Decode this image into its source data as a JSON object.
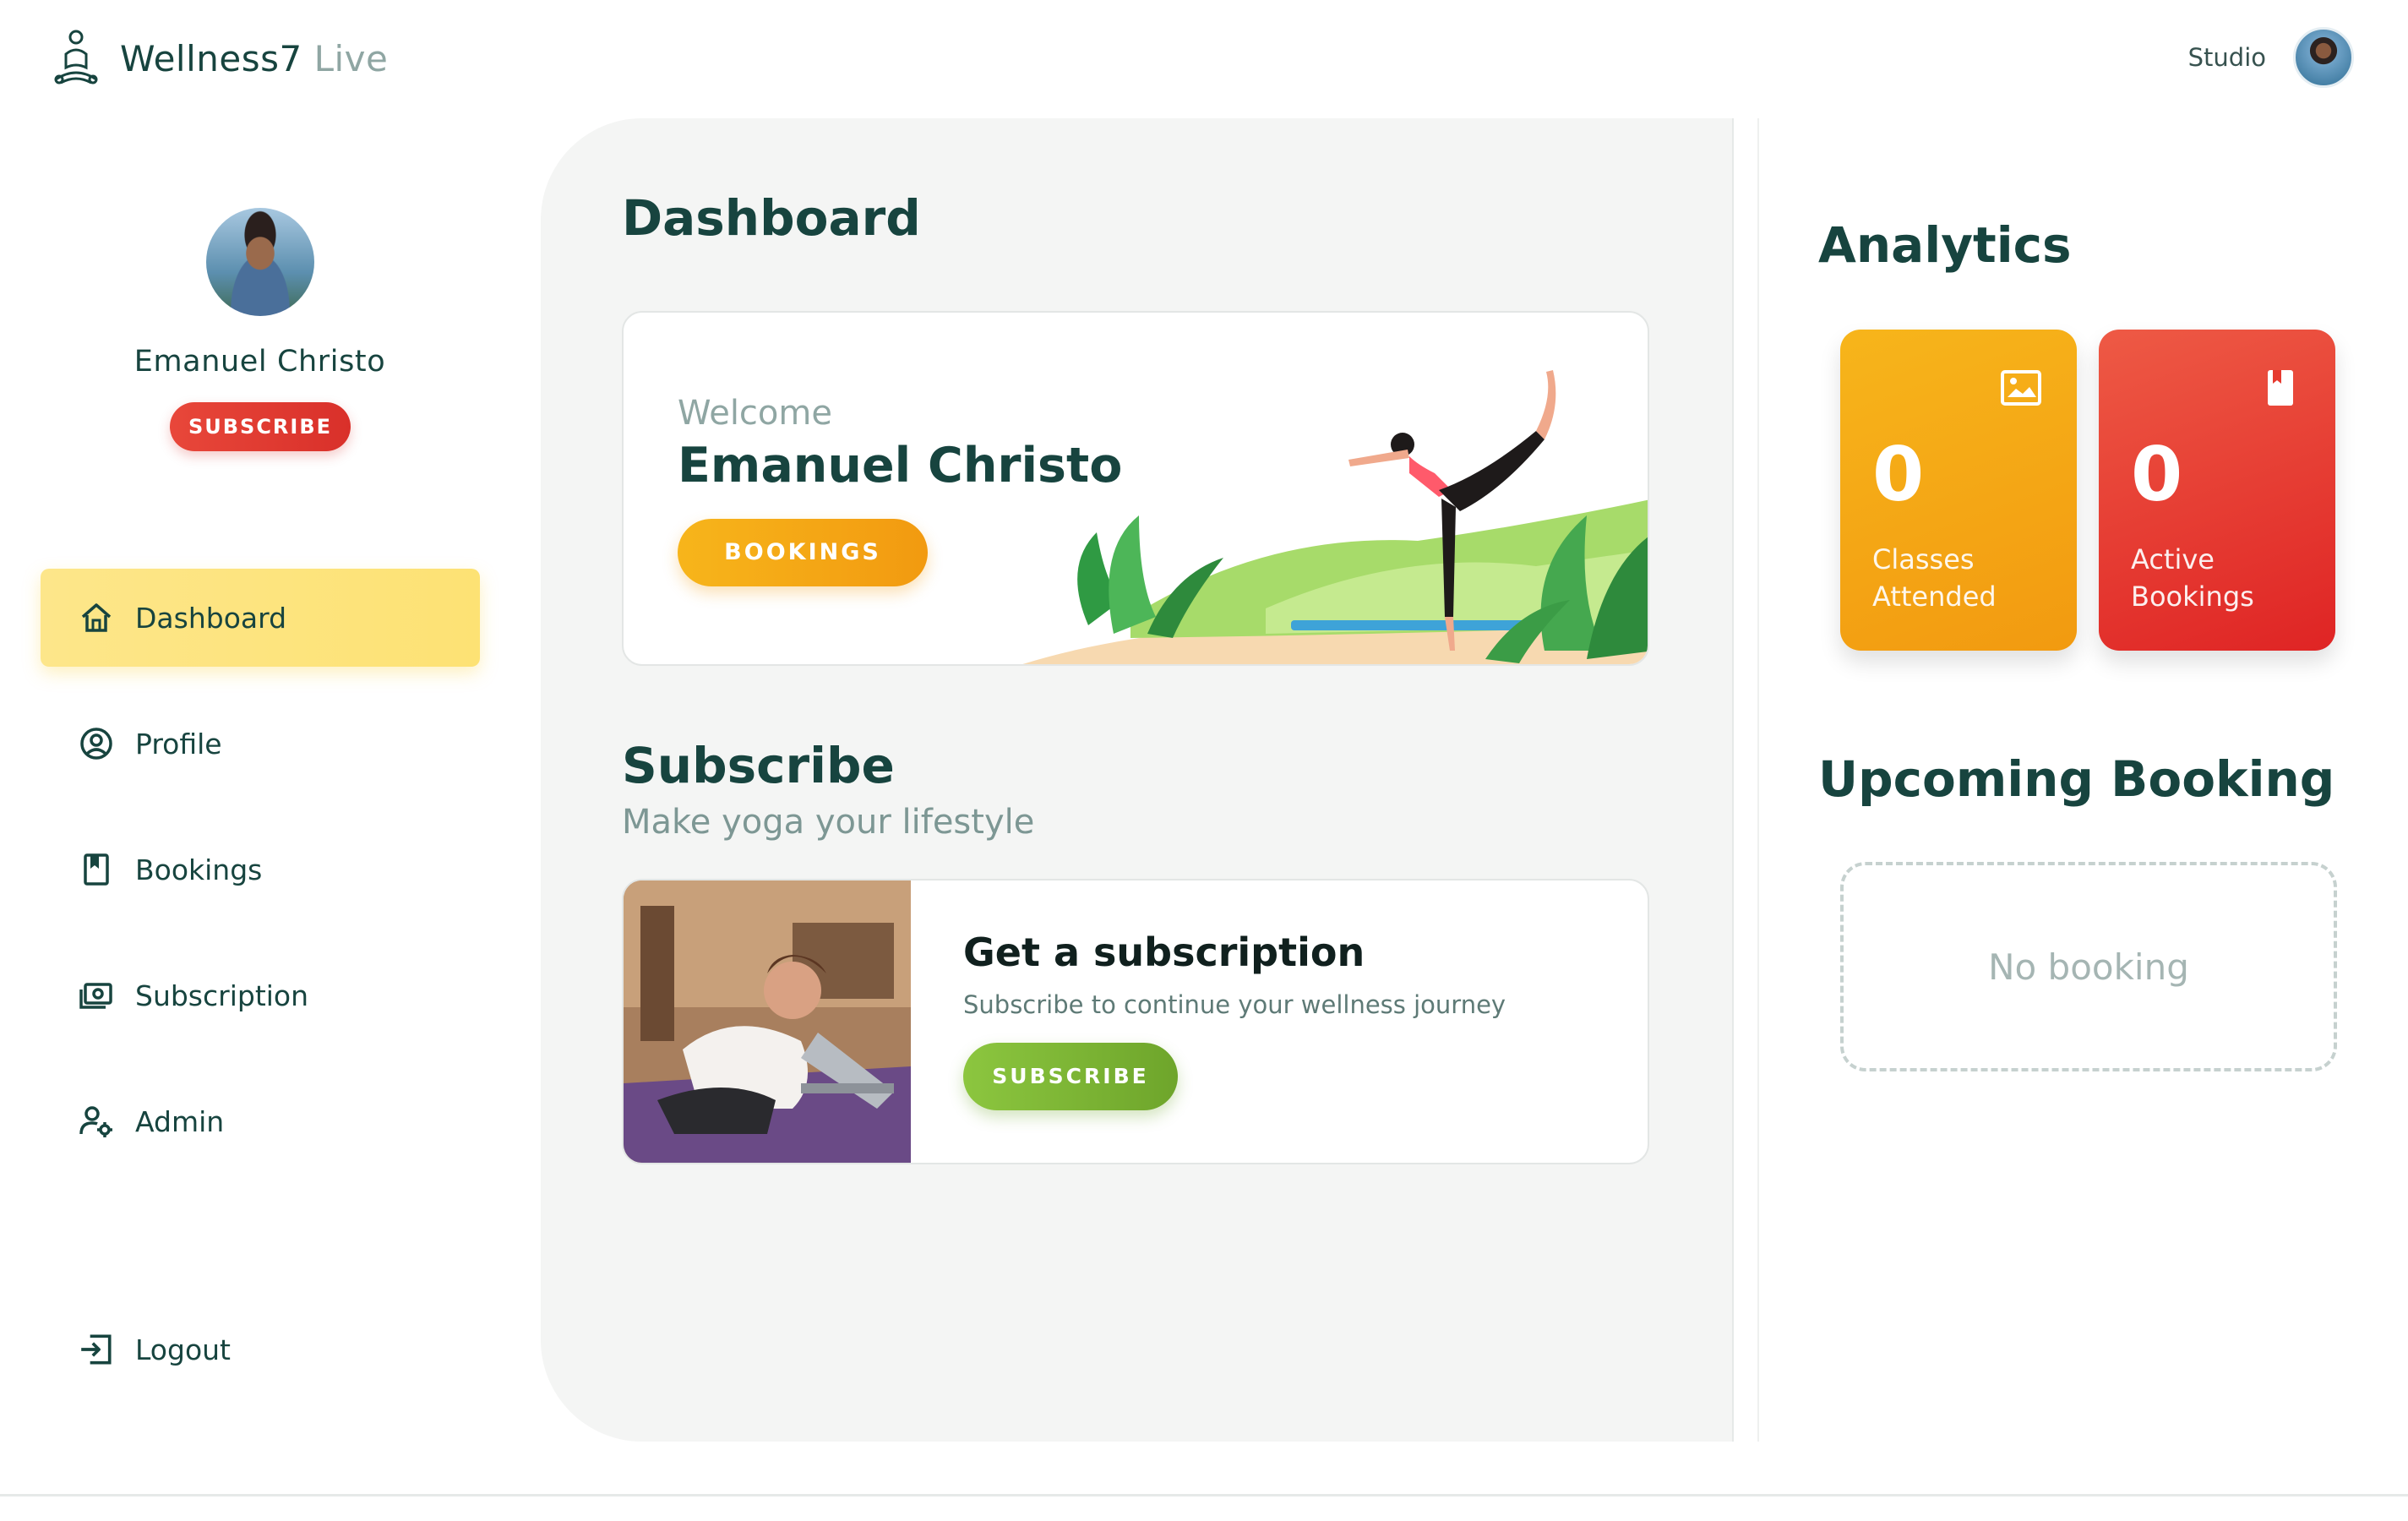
{
  "header": {
    "brand_name": "Wellness7",
    "brand_suffix": "Live",
    "studio_label": "Studio"
  },
  "sidebar": {
    "user_name": "Emanuel Christo",
    "subscribe_label": "SUBSCRIBE",
    "items": [
      {
        "label": "Dashboard",
        "icon": "home-icon",
        "active": true
      },
      {
        "label": "Profile",
        "icon": "user-circle-icon"
      },
      {
        "label": "Bookings",
        "icon": "bookmark-icon"
      },
      {
        "label": "Subscription",
        "icon": "money-icon"
      },
      {
        "label": "Admin",
        "icon": "admin-gear-icon"
      }
    ],
    "logout_label": "Logout"
  },
  "main": {
    "title": "Dashboard",
    "welcome": {
      "label": "Welcome",
      "name": "Emanuel Christo",
      "button_label": "BOOKINGS"
    },
    "subscribe_section": {
      "title": "Subscribe",
      "tagline": "Make yoga your lifestyle",
      "card_title": "Get a subscription",
      "card_description": "Subscribe to continue your wellness journey",
      "button_label": "SUBSCRIBE"
    }
  },
  "analytics": {
    "title": "Analytics",
    "stats": [
      {
        "value": "0",
        "label": "Classes Attended",
        "icon": "image-icon",
        "color": "#f4a915"
      },
      {
        "value": "0",
        "label": "Active Bookings",
        "icon": "bookmark-icon",
        "color": "#e63a2f"
      }
    ]
  },
  "upcoming": {
    "title": "Upcoming Booking",
    "empty_text": "No booking"
  },
  "colors": {
    "primary_text": "#17443f",
    "accent_yellow": "#fde274",
    "accent_orange": "#f29a10",
    "accent_red": "#df2424",
    "accent_green": "#6ea52b"
  }
}
